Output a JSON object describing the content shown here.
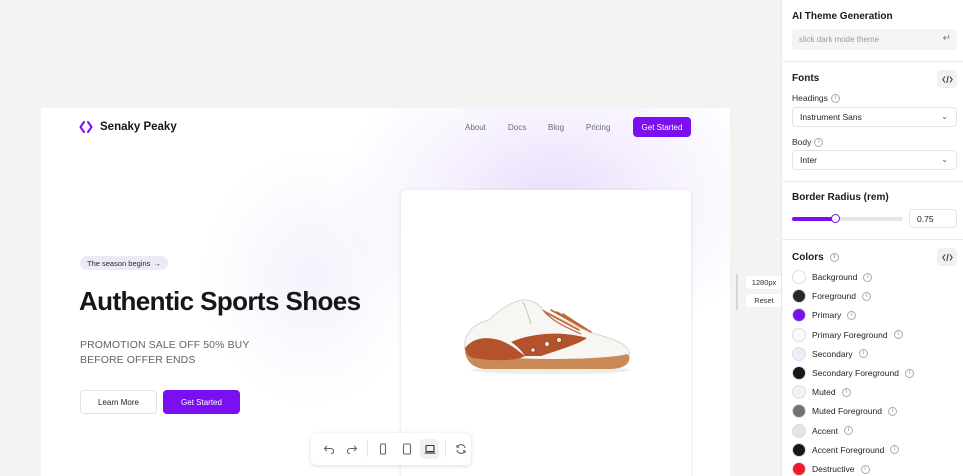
{
  "preview": {
    "logo_text": "Senaky Peaky",
    "nav_links": [
      "About",
      "Docs",
      "Blog",
      "Pricing"
    ],
    "nav_cta": "Get Started",
    "badge": "The season begins",
    "hero_title": "Authentic Sports Shoes",
    "hero_subtitle": "PROMOTION SALE OFF 50% BUY BEFORE OFFER ENDS",
    "btn_learn_more": "Learn More",
    "btn_get_started": "Get Started"
  },
  "viewport": {
    "size_label": "1280px",
    "reset_label": "Reset"
  },
  "toolbar": {
    "icons": [
      "undo-icon",
      "redo-icon",
      "mobile-icon",
      "tablet-icon",
      "laptop-icon",
      "refresh-icon"
    ],
    "active": "laptop-icon"
  },
  "panel": {
    "ai": {
      "title": "AI Theme Generation",
      "placeholder": "slick dark mode theme"
    },
    "fonts": {
      "title": "Fonts",
      "headings_label": "Headings",
      "headings_value": "Instrument Sans",
      "body_label": "Body",
      "body_value": "Inter"
    },
    "radius": {
      "title": "Border Radius (rem)",
      "value": "0.75",
      "fraction": 0.39
    },
    "colors": {
      "title": "Colors",
      "items": [
        {
          "label": "Background",
          "color": "#ffffff"
        },
        {
          "label": "Foreground",
          "color": "#27272a"
        },
        {
          "label": "Primary",
          "color": "#7a0ff0"
        },
        {
          "label": "Primary Foreground",
          "color": "#fafafa"
        },
        {
          "label": "Secondary",
          "color": "#eeebfb"
        },
        {
          "label": "Secondary Foreground",
          "color": "#18181b"
        },
        {
          "label": "Muted",
          "color": "#f3f3f6"
        },
        {
          "label": "Muted Foreground",
          "color": "#71717a"
        },
        {
          "label": "Accent",
          "color": "#e4e4e7"
        },
        {
          "label": "Accent Foreground",
          "color": "#18181b"
        },
        {
          "label": "Destructive",
          "color": "#ef1b2c"
        }
      ]
    }
  },
  "colors": {
    "primary": "#7a0ff0"
  }
}
